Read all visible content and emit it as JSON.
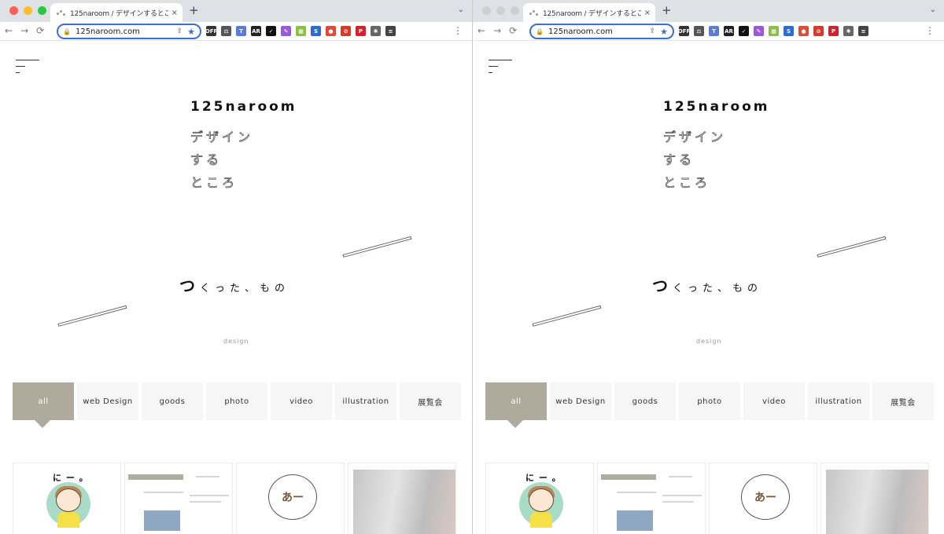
{
  "windows": [
    {
      "id": "left",
      "active": true,
      "tab_title": "125naroom / デザインするところ",
      "url": "125naroom.com"
    },
    {
      "id": "right",
      "active": false,
      "tab_title": "125naroom / デザインするところ",
      "url": "125naroom.com"
    }
  ],
  "chrome": {
    "new_tab": "+",
    "tab_close": "×",
    "tab_menu": "⌄",
    "back": "←",
    "forward": "→",
    "reload": "⟳",
    "menu": "⋮",
    "extensions": [
      {
        "name": "off-extension",
        "label": "OFF",
        "color": "#333333"
      },
      {
        "name": "scale-extension",
        "label": "⚖",
        "color": "#555555"
      },
      {
        "name": "translate-extension",
        "label": "T",
        "color": "#5b7bd6"
      },
      {
        "name": "ar-extension",
        "label": "AR",
        "color": "#222222"
      },
      {
        "name": "check-extension",
        "label": "✓",
        "color": "#111111"
      },
      {
        "name": "feather-extension",
        "label": "✎",
        "color": "#9b59d6"
      },
      {
        "name": "table-extension",
        "label": "▦",
        "color": "#8bbf4a"
      },
      {
        "name": "s-extension",
        "label": "S",
        "color": "#2d6bd0"
      },
      {
        "name": "chrome-extension",
        "label": "●",
        "color": "#e04a3a"
      },
      {
        "name": "block-extension",
        "label": "⊘",
        "color": "#d63a2a"
      },
      {
        "name": "pinterest-extension",
        "label": "P",
        "color": "#d3212d"
      },
      {
        "name": "puzzle-extension",
        "label": "✱",
        "color": "#666666"
      },
      {
        "name": "list-extension",
        "label": "≡",
        "color": "#444444"
      }
    ]
  },
  "site": {
    "brand": "125naroom",
    "tagline": [
      "デザイン",
      "する",
      "ところ"
    ],
    "made_big": "つ",
    "made_rest": "くった、もの",
    "category_label": "design",
    "filters": [
      "all",
      "web Design",
      "goods",
      "photo",
      "video",
      "illustration",
      "展覧会"
    ],
    "active_filter": "all",
    "card_texts": {
      "ni": "に ー 。",
      "bubble": "あー"
    }
  },
  "colors": {
    "accent": "#aeab9d",
    "tab_bar": "#dee1e6",
    "omnibox_border": "#3b6fd4"
  }
}
